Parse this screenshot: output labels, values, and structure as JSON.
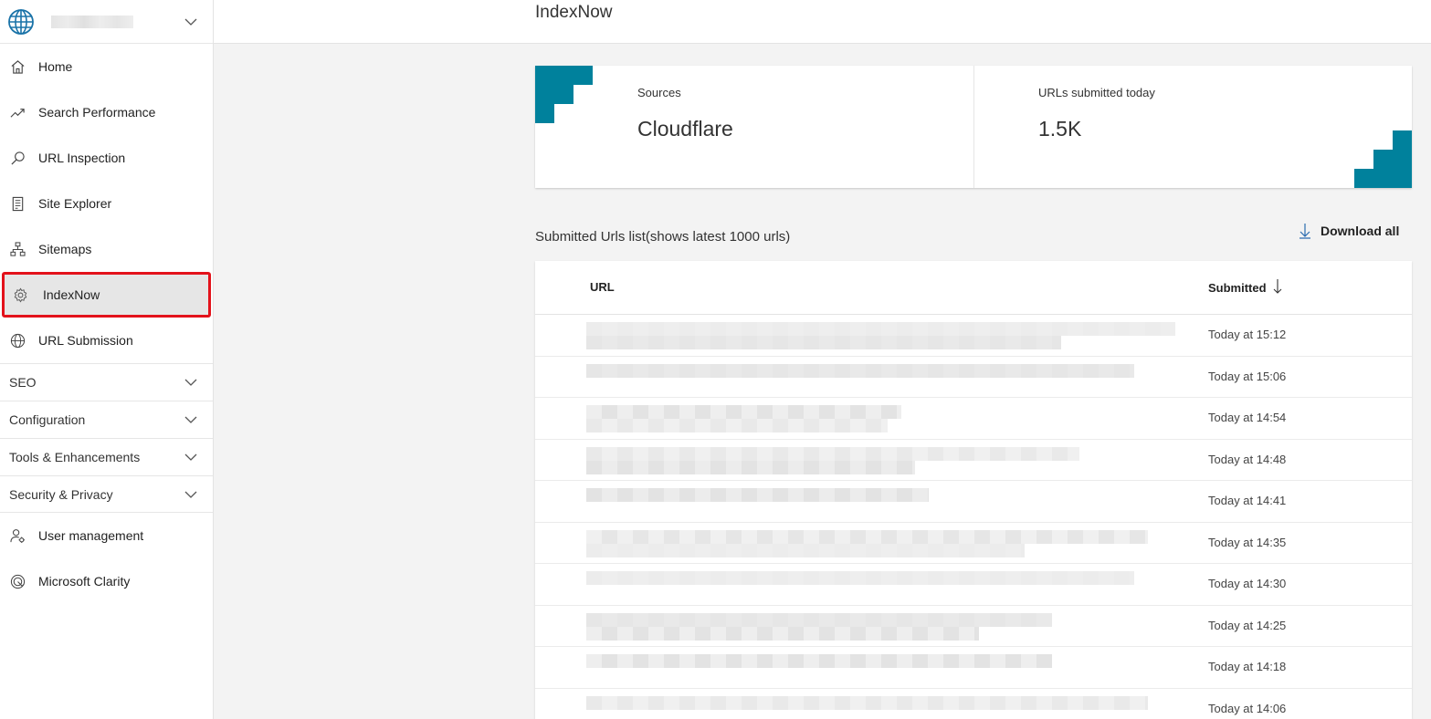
{
  "sidebar": {
    "site_icon": "globe-icon",
    "items": [
      {
        "label": "Home",
        "icon": "home-icon"
      },
      {
        "label": "Search Performance",
        "icon": "trend-icon"
      },
      {
        "label": "URL Inspection",
        "icon": "search-icon"
      },
      {
        "label": "Site Explorer",
        "icon": "document-icon"
      },
      {
        "label": "Sitemaps",
        "icon": "sitemap-icon"
      },
      {
        "label": "IndexNow",
        "icon": "gear-icon",
        "active": true
      },
      {
        "label": "URL Submission",
        "icon": "globe-icon"
      }
    ],
    "sections": [
      {
        "label": "SEO"
      },
      {
        "label": "Configuration"
      },
      {
        "label": "Tools & Enhancements"
      },
      {
        "label": "Security & Privacy"
      }
    ],
    "bottom_items": [
      {
        "label": "User management",
        "icon": "user-gear-icon"
      },
      {
        "label": "Microsoft Clarity",
        "icon": "clarity-icon"
      }
    ]
  },
  "header": {
    "title": "IndexNow"
  },
  "cards": [
    {
      "label": "Sources",
      "value": "Cloudflare"
    },
    {
      "label": "URLs submitted today",
      "value": "1.5K"
    }
  ],
  "list": {
    "title": "Submitted Urls list(shows latest 1000 urls)",
    "download_label": "Download all",
    "columns": {
      "url": "URL",
      "submitted": "Submitted"
    },
    "rows": [
      {
        "time": "Today at 15:12"
      },
      {
        "time": "Today at 15:06"
      },
      {
        "time": "Today at 14:54"
      },
      {
        "time": "Today at 14:48"
      },
      {
        "time": "Today at 14:41"
      },
      {
        "time": "Today at 14:35"
      },
      {
        "time": "Today at 14:30"
      },
      {
        "time": "Today at 14:25"
      },
      {
        "time": "Today at 14:18"
      },
      {
        "time": "Today at 14:06"
      }
    ]
  },
  "colors": {
    "accent": "#00819c",
    "highlight_border": "#e3121b"
  }
}
